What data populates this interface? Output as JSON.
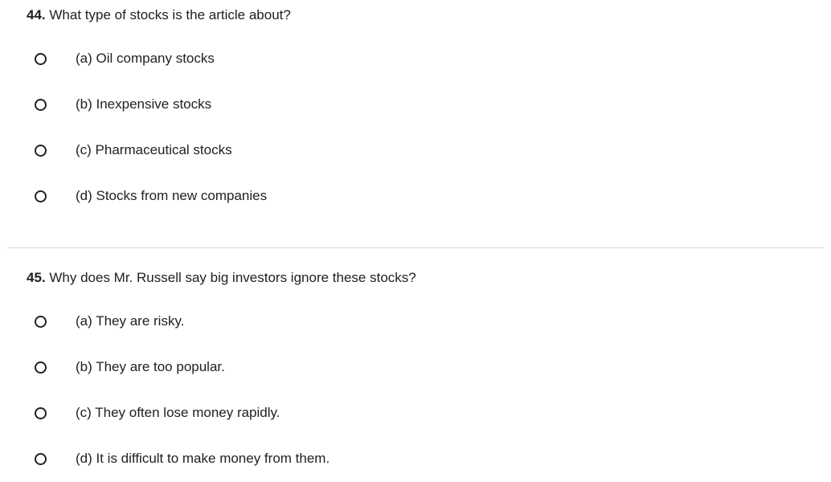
{
  "questions": [
    {
      "number": "44.",
      "text": " What type of stocks is the article about?",
      "options": [
        "(a) Oil company stocks",
        "(b) Inexpensive stocks",
        "(c) Pharmaceutical stocks",
        "(d) Stocks from new companies"
      ]
    },
    {
      "number": "45.",
      "text": " Why does Mr. Russell say big investors ignore these stocks?",
      "options": [
        "(a) They are risky.",
        "(b) They are too popular.",
        "(c) They often lose money rapidly.",
        "(d) It is difficult to make money from them."
      ]
    }
  ]
}
